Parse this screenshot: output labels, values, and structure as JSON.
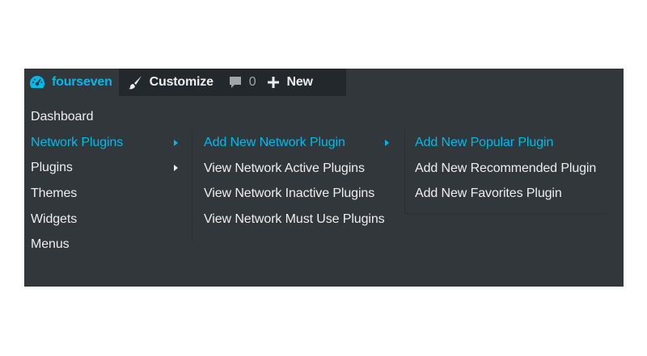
{
  "admin_bar": {
    "site_name": "fourseven",
    "customize_label": "Customize",
    "comments_count": "0",
    "new_label": "New",
    "accent_color": "#00b9eb",
    "icons": [
      "dashboard-icon",
      "brush-icon",
      "comment-icon",
      "plus-icon"
    ]
  },
  "menu": {
    "items": [
      {
        "label": "Dashboard",
        "active": false,
        "has_submenu": false
      },
      {
        "label": "Network Plugins",
        "active": true,
        "has_submenu": true
      },
      {
        "label": "Plugins",
        "active": false,
        "has_submenu": true
      },
      {
        "label": "Themes",
        "active": false,
        "has_submenu": false
      },
      {
        "label": "Widgets",
        "active": false,
        "has_submenu": false
      },
      {
        "label": "Menus",
        "active": false,
        "has_submenu": false
      }
    ]
  },
  "submenu": {
    "items": [
      {
        "label": "Add New Network Plugin",
        "active": true,
        "has_submenu": true
      },
      {
        "label": "View Network Active Plugins",
        "active": false
      },
      {
        "label": "View Network Inactive Plugins",
        "active": false
      },
      {
        "label": "View Network Must Use Plugins",
        "active": false
      }
    ]
  },
  "subsubmenu": {
    "items": [
      {
        "label": "Add New Popular Plugin",
        "active": true
      },
      {
        "label": "Add New Recommended Plugin",
        "active": false
      },
      {
        "label": "Add New Favorites Plugin",
        "active": false
      }
    ]
  },
  "colors": {
    "bar_background": "#23282d",
    "menu_background": "#32373c",
    "text": "#eeeeee",
    "highlight": "#00b9eb"
  }
}
